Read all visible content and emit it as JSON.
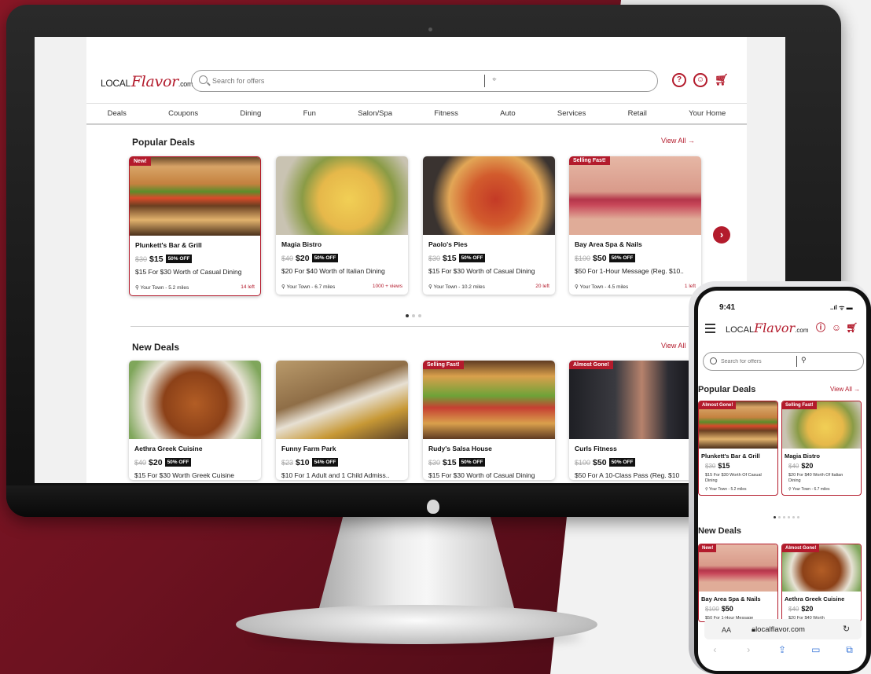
{
  "desktop": {
    "logo": {
      "local": "LOCAL",
      "flavor": "Flavor",
      "dotcom": ".com"
    },
    "search": {
      "placeholder": "Search for offers",
      "location_placeholder": ""
    },
    "header_icons": [
      "help-icon",
      "account-icon",
      "cart-icon"
    ],
    "nav": [
      "Deals",
      "Coupons",
      "Dining",
      "Fun",
      "Salon/Spa",
      "Fitness",
      "Auto",
      "Services",
      "Retail",
      "Your Home"
    ],
    "popular": {
      "title": "Popular Deals",
      "view_all": "View All →",
      "cards": [
        {
          "tag": "New!",
          "name": "Plunkett's Bar & Grill",
          "was": "$30",
          "now": "$15",
          "off": "50% OFF",
          "desc": "$15 For $30 Worth of Casual Dining",
          "loc": "Your Town - 5.2 miles",
          "right": "14 left"
        },
        {
          "tag": "",
          "name": "Magia Bistro",
          "was": "$40",
          "now": "$20",
          "off": "50% OFF",
          "desc": "$20 For $40 Worth of Italian Dining",
          "loc": "Your Town - 6.7 miles",
          "right": "1000 + views"
        },
        {
          "tag": "",
          "name": "Paolo's Pies",
          "was": "$30",
          "now": "$15",
          "off": "50% OFF",
          "desc": "$15 For $30 Worth of Casual Dining",
          "loc": "Your Town - 10.2 miles",
          "right": "20 left"
        },
        {
          "tag": "Selling Fast!",
          "name": "Bay Area Spa & Nails",
          "was": "$100",
          "now": "$50",
          "off": "50% OFF",
          "desc": "$50 For 1-Hour Message (Reg. $10..",
          "loc": "Your Town - 4.5 miles",
          "right": "1 left"
        }
      ]
    },
    "new": {
      "title": "New Deals",
      "view_all": "View All",
      "cards": [
        {
          "tag": "",
          "name": "Aethra Greek Cuisine",
          "was": "$40",
          "now": "$20",
          "off": "50% OFF",
          "desc": "$15 For $30 Worth Greek Cuisine"
        },
        {
          "tag": "",
          "name": "Funny Farm Park",
          "was": "$23",
          "now": "$10",
          "off": "54% OFF",
          "desc": "$10 For 1 Adult and 1 Child Admiss.."
        },
        {
          "tag": "Selling Fast!",
          "name": "Rudy's Salsa House",
          "was": "$30",
          "now": "$15",
          "off": "50% OFF",
          "desc": "$15 For $30 Worth of Casual Dining"
        },
        {
          "tag": "Almost Gone!",
          "name": "Curls Fitness",
          "was": "$100",
          "now": "$50",
          "off": "50% OFF",
          "desc": "$50 For A 10-Class Pass (Reg. $10"
        }
      ]
    },
    "carousel_dots": 3,
    "carousel_active": 1
  },
  "phone": {
    "time": "9:41",
    "status": "..ıl ᯤ ▬",
    "logo": {
      "local": "LOCAL",
      "flavor": "Flavor",
      "dotcom": ".com"
    },
    "search": {
      "placeholder": "Search for offers"
    },
    "popular": {
      "title": "Popular Deals",
      "view_all": "View All →",
      "cards": [
        {
          "tag": "Almost Gone!",
          "name": "Plunkett's Bar & Grill",
          "was": "$30",
          "now": "$15",
          "desc": "$15 For $30 Worth Of Casual Dining",
          "loc": "Your Town - 5.2 miles"
        },
        {
          "tag": "Selling Fast!",
          "name": "Magia Bistro",
          "was": "$40",
          "now": "$20",
          "desc": "$20 For $40 Worth Of Italian Dining",
          "loc": "Your Town - 6.7 miles"
        }
      ]
    },
    "new": {
      "title": "New Deals",
      "cards": [
        {
          "tag": "New!",
          "name": "Bay Area Spa & Nails",
          "was": "$100",
          "now": "$50",
          "desc": "$50 For 1-Hour Message"
        },
        {
          "tag": "Almost Gone!",
          "name": "Aethra Greek Cuisine",
          "was": "$40",
          "now": "$20",
          "desc": "$20 For $40 Worth"
        }
      ]
    },
    "browser": {
      "aa": "AA",
      "url": "localflavor.com"
    }
  },
  "colors": {
    "brand": "#b31b2c",
    "backdrop": "#7a1424"
  }
}
